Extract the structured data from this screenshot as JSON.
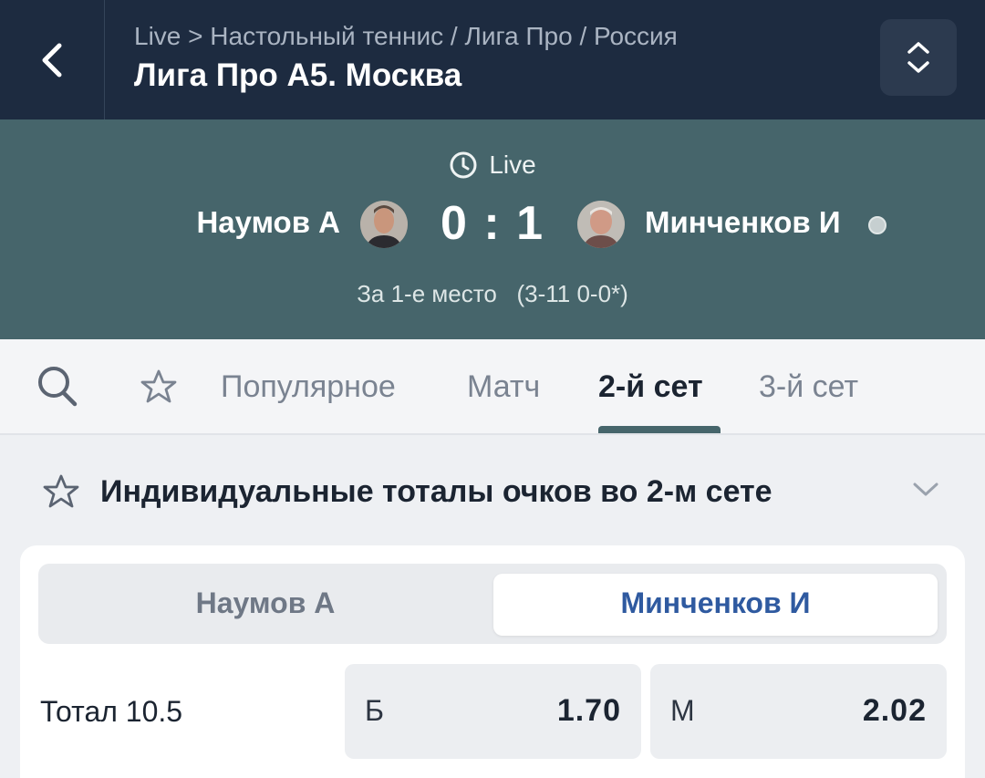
{
  "header": {
    "breadcrumb": "Live > Настольный теннис / Лига Про / Россия",
    "title": "Лига Про А5. Москва",
    "back_icon": "chevron-left-icon",
    "expand_icon": "chevron-up-down-icon"
  },
  "scoreboard": {
    "status": "Live",
    "status_icon": "clock-icon",
    "team1": "Наумов А",
    "team2": "Минченков И",
    "score": "0 : 1",
    "match_info": "За 1-е место   (3-11 0-0*)",
    "serving": "team2"
  },
  "tabs": {
    "items": [
      {
        "label": "Популярное",
        "active": false
      },
      {
        "label": "Матч",
        "active": false
      },
      {
        "label": "2-й сет",
        "active": true
      },
      {
        "label": "3-й сет",
        "active": false
      }
    ]
  },
  "market": {
    "title": "Индивидуальные тоталы очков во 2-м сете",
    "segment": {
      "options": [
        "Наумов А",
        "Минченков И"
      ],
      "selected": "Минченков И"
    },
    "rows": [
      {
        "label": "Тотал 10.5",
        "odds": [
          {
            "key": "Б",
            "value": "1.70"
          },
          {
            "key": "М",
            "value": "2.02"
          }
        ]
      }
    ]
  },
  "colors": {
    "header_bg": "#1d2b40",
    "scoreboard_bg": "#46656b",
    "accent_blue": "#2f5aa0"
  }
}
